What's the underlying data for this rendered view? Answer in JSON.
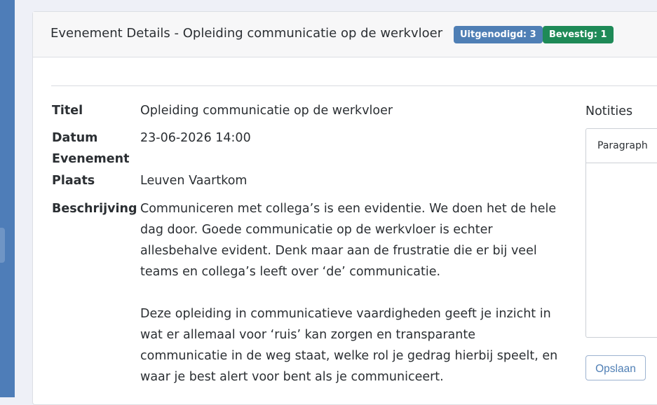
{
  "header": {
    "title": "Evenement Details - Opleiding communicatie op de werkvloer",
    "badges": {
      "invited": "Uitgenodigd: 3",
      "confirmed": "Bevestig: 1"
    }
  },
  "details": {
    "title_label": "Titel",
    "title_value": "Opleiding communicatie op de werkvloer",
    "date_label_line1": "Datum",
    "date_label_line2": "Evenement",
    "date_value": "23-06-2026 14:00",
    "place_label": "Plaats",
    "place_value": "Leuven Vaartkom",
    "description_label": "Beschrijving",
    "description_lines": [
      "Communiceren met collega’s is een evidentie. We doen het de hele",
      "dag door. Goede communicatie op de werkvloer is echter",
      "allesbehalve evident. Denk maar aan de frustratie die er bij veel",
      "teams en collega’s leeft over ‘de’ communicatie.",
      "Deze opleiding in communicatieve vaardigheden geeft je inzicht in",
      "wat er allemaal voor ‘ruis’ kan zorgen en transparante",
      "communicatie in de weg staat, welke rol je gedrag hierbij speelt, en",
      "waar je best alert voor bent als je communiceert."
    ]
  },
  "notes": {
    "label": "Notities",
    "format_select": "Paragraph",
    "save_label": "Opslaan"
  },
  "colors": {
    "sidebar": "#4e7db8",
    "badge_invited": "#4f7fb5",
    "badge_confirmed": "#1e8a57"
  }
}
